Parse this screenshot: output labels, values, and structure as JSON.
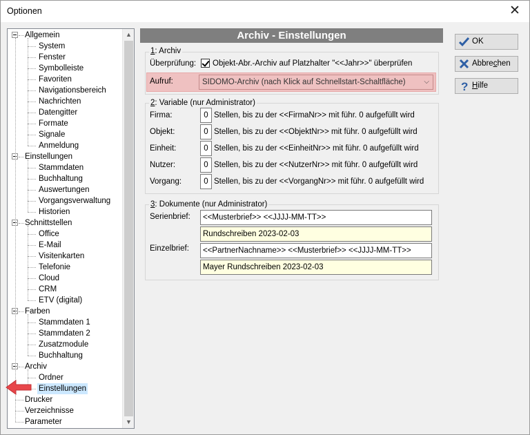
{
  "window": {
    "title": "Optionen",
    "close_glyph": "✕"
  },
  "tree": {
    "groups": [
      {
        "label": "Allgemein",
        "children": [
          "System",
          "Fenster",
          "Symbolleiste",
          "Favoriten",
          "Navigationsbereich",
          "Nachrichten",
          "Datengitter",
          "Formate",
          "Signale",
          "Anmeldung"
        ]
      },
      {
        "label": "Einstellungen",
        "children": [
          "Stammdaten",
          "Buchhaltung",
          "Auswertungen",
          "Vorgangsverwaltung",
          "Historien"
        ]
      },
      {
        "label": "Schnittstellen",
        "children": [
          "Office",
          "E-Mail",
          "Visitenkarten",
          "Telefonie",
          "Cloud",
          "CRM",
          "ETV (digital)"
        ]
      },
      {
        "label": "Farben",
        "children": [
          "Stammdaten 1",
          "Stammdaten 2",
          "Zusatzmodule",
          "Buchhaltung"
        ]
      },
      {
        "label": "Archiv",
        "children": [
          "Ordner",
          "Einstellungen"
        ]
      }
    ],
    "leaves": [
      "Drucker",
      "Verzeichnisse",
      "Parameter"
    ],
    "selected": "Einstellungen",
    "pointer_color": "#e8464a"
  },
  "panel": {
    "header": "Archiv - Einstellungen",
    "archiv": {
      "group_label_num": "1",
      "group_label_rest": ": Archiv",
      "check_label": "Überprüfung:",
      "check_text": "Objekt-Abr.-Archiv auf Platzhalter \"<<Jahr>>\" überprüfen",
      "checked": true,
      "aufruf_label": "Aufruf:",
      "aufruf_value": "SIDOMO-Archiv (nach Klick auf Schnellstart-Schaltfläche)",
      "highlight_color": "#efc1c1"
    },
    "variable": {
      "group_label_num": "2",
      "group_label_rest": ": Variable  (nur Administrator)",
      "rows": [
        {
          "label": "Firma:",
          "value": "0",
          "text": "Stellen, bis zu der <<FirmaNr>> mit führ. 0 aufgefüllt wird"
        },
        {
          "label": "Objekt:",
          "value": "0",
          "text": "Stellen, bis zu der <<ObjektNr>> mit führ. 0 aufgefüllt wird"
        },
        {
          "label": "Einheit:",
          "value": "0",
          "text": "Stellen, bis zu der <<EinheitNr>> mit führ. 0 aufgefüllt wird"
        },
        {
          "label": "Nutzer:",
          "value": "0",
          "text": "Stellen, bis zu der <<NutzerNr>> mit führ. 0 aufgefüllt wird"
        },
        {
          "label": "Vorgang:",
          "value": "0",
          "text": "Stellen, bis zu der <<VorgangNr>> mit führ. 0 aufgefüllt wird"
        }
      ]
    },
    "dokumente": {
      "group_label_num": "3",
      "group_label_rest": ": Dokumente  (nur Administrator)",
      "serienbrief_label": "Serienbrief:",
      "serienbrief_value": "<<Musterbrief>> <<JJJJ-MM-TT>>",
      "serienbrief_preview": "Rundschreiben 2023-02-03",
      "einzelbrief_label": "Einzelbrief:",
      "einzelbrief_value": "<<PartnerNachname>> <<Musterbrief>> <<JJJJ-MM-TT>>",
      "einzelbrief_preview": "Mayer Rundschreiben 2023-02-03",
      "preview_color": "#ffffe1"
    }
  },
  "buttons": {
    "ok": {
      "label": "OK",
      "icon": "check-icon",
      "color": "#2e5fa5"
    },
    "cancel": {
      "label_pre": "Abbre",
      "label_ul": "c",
      "label_post": "hen",
      "icon": "x-icon",
      "color": "#2e5fa5"
    },
    "help": {
      "label_ul": "H",
      "label_post": "ilfe",
      "icon": "question-icon",
      "color": "#2e5fa5"
    }
  }
}
